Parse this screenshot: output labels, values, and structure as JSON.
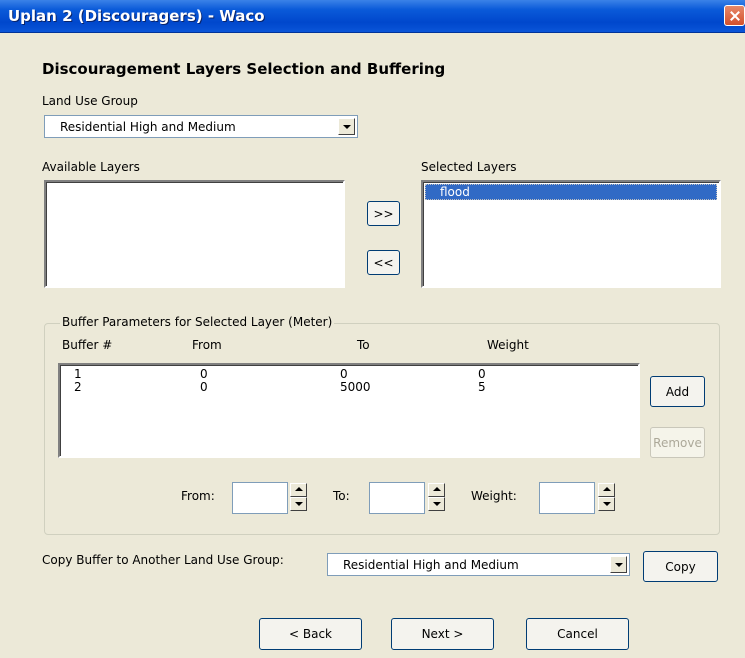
{
  "window": {
    "title": "Uplan 2 (Discouragers) - Waco"
  },
  "heading": "Discouragement Layers Selection and Buffering",
  "land_use_group": {
    "label": "Land Use Group",
    "selected": "Residential High and Medium"
  },
  "available_layers": {
    "label": "Available Layers",
    "items": []
  },
  "selected_layers": {
    "label": "Selected Layers",
    "items": [
      "flood"
    ]
  },
  "transfer": {
    "add_label": ">>",
    "remove_label": "<<"
  },
  "buffer": {
    "group_label": "Buffer Parameters for Selected Layer (Meter)",
    "columns": [
      "Buffer #",
      "From",
      "To",
      "Weight"
    ],
    "rows": [
      [
        "1",
        "0",
        "0",
        "0"
      ],
      [
        "2",
        "0",
        "5000",
        "5"
      ]
    ],
    "add_label": "Add",
    "remove_label": "Remove",
    "from_label": "From:",
    "to_label": "To:",
    "weight_label": "Weight:",
    "from_value": "",
    "to_value": "",
    "weight_value": ""
  },
  "copy": {
    "label": "Copy Buffer to Another Land Use Group:",
    "selected": "Residential High and Medium",
    "button_label": "Copy"
  },
  "footer": {
    "back_label": "< Back",
    "next_label": "Next >",
    "cancel_label": "Cancel"
  }
}
